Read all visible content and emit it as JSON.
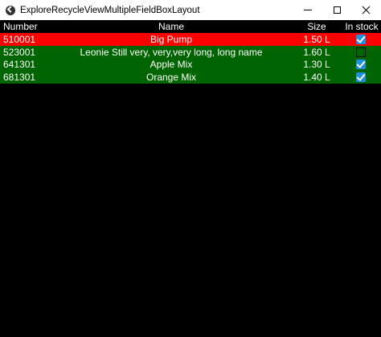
{
  "window": {
    "title": "ExploreRecycleViewMultipleFieldBoxLayout",
    "icon": "kivy-app-icon"
  },
  "colors": {
    "selected_row": "#ff0000",
    "row": "#006400",
    "background": "#000000",
    "header_text": "#ffffff",
    "checkbox": "#1e90e0"
  },
  "table": {
    "headers": {
      "number": "Number",
      "name": "Name",
      "size": "Size",
      "stock": "In stock"
    },
    "rows": [
      {
        "number": "510001",
        "name": "Big Pump",
        "size": "1.50 L",
        "in_stock": true,
        "selected": true
      },
      {
        "number": "523001",
        "name": "Leonie Still very, very,very long, long name",
        "size": "1.60 L",
        "in_stock": false,
        "selected": false
      },
      {
        "number": "641301",
        "name": "Apple Mix",
        "size": "1.30 L",
        "in_stock": true,
        "selected": false
      },
      {
        "number": "681301",
        "name": "Orange Mix",
        "size": "1.40 L",
        "in_stock": true,
        "selected": false
      }
    ]
  }
}
